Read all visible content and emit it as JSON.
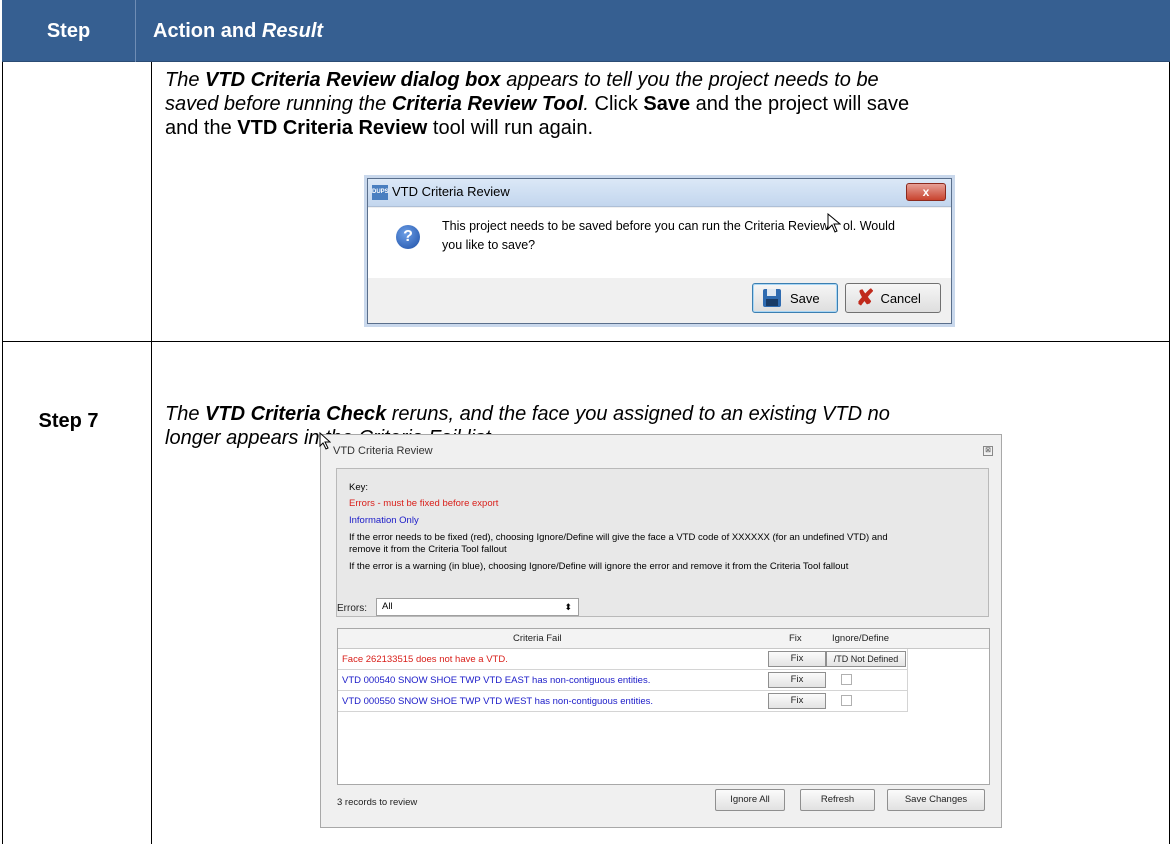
{
  "table": {
    "header_step": "Step",
    "header_action_plain": "Action and ",
    "header_action_italic": "Result",
    "row1": {
      "p1_a": "The ",
      "p1_b": "VTD Criteria Review dialog box",
      "p1_c": " appears to tell you the project needs to be",
      "p2_a": "saved before running the ",
      "p2_b": "Criteria Review Tool",
      "p2_c": ".",
      "p2_d": " Click ",
      "p2_e": "Save",
      "p2_f": " and the project will save",
      "p3_a": "and the ",
      "p3_b": "VTD Criteria Review",
      "p3_c": " tool will run again."
    },
    "row2": {
      "step": "Step 7",
      "p1_a": "The ",
      "p1_b": "VTD Criteria Check",
      "p1_c": " reruns, and the face you assigned to an existing VTD no",
      "p2": "longer appears in the Criteria Fail list."
    }
  },
  "dialog1": {
    "app_icon_text": "DUPS",
    "title": "VTD Criteria Review",
    "close_glyph": "x",
    "message_line1": "This project needs to be saved before you can run the Criteria Review",
    "message_line1_tail": "ol. Would",
    "message_line2": "you like to save?",
    "question_glyph": "?",
    "save_label": "Save",
    "cancel_label": "Cancel"
  },
  "dialog2": {
    "title": "VTD Criteria Review",
    "key_label": "Key:",
    "key_errors": "Errors - must be fixed before export",
    "key_info": "Information Only",
    "key_line1": "If the error needs to be fixed (red), choosing Ignore/Define will give the face a VTD code of XXXXXX (for an undefined VTD) and",
    "key_line2": "remove it from the Criteria Tool fallout",
    "key_line3": "If the error is a warning (in blue), choosing Ignore/Define will ignore the error and remove it from the Criteria Tool fallout",
    "errors_label": "Errors:",
    "errors_value": "All",
    "col_criteria": "Criteria Fail",
    "col_fix": "Fix",
    "col_ignore": "Ignore/Define",
    "rows": [
      {
        "text": "Face 262133515 does not have a VTD.",
        "fix": "Fix",
        "ignore": "/TD Not Defined",
        "color": "#d9201b"
      },
      {
        "text": "VTD 000540 SNOW SHOE TWP VTD EAST has non-contiguous entities.",
        "fix": "Fix",
        "color": "#1a1ac8"
      },
      {
        "text": "VTD 000550 SNOW SHOE TWP VTD WEST has non-contiguous entities.",
        "fix": "Fix",
        "color": "#1a1ac8"
      }
    ],
    "records": "3 records to review",
    "ignore_all": "Ignore All",
    "refresh": "Refresh",
    "save_changes": "Save Changes"
  }
}
